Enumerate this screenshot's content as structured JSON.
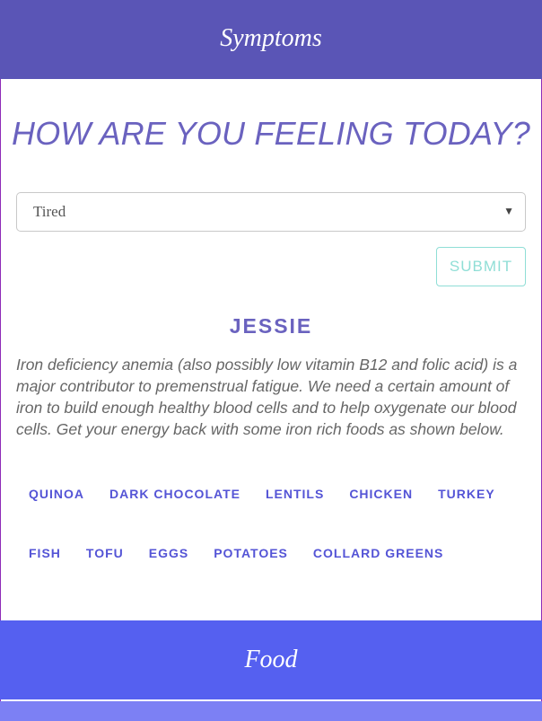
{
  "header": {
    "title": "Symptoms"
  },
  "main": {
    "question": "HOW ARE YOU FEELING TODAY?",
    "symptom_select": {
      "selected": "Tired",
      "caret": "▼"
    },
    "submit_label": "SUBMIT",
    "result": {
      "name": "JESSIE",
      "advice": "Iron deficiency anemia (also possibly low vitamin B12 and folic acid) is a major contributor to premenstrual fatigue. We need a certain amount of iron to build enough healthy blood cells and to help oxygenate our blood cells. Get your energy back with some iron rich foods as shown below.",
      "foods_row1": [
        "QUINOA",
        "DARK CHOCOLATE",
        "LENTILS",
        "CHICKEN",
        "TURKEY"
      ],
      "foods_row2": [
        "FISH",
        "TOFU",
        "EGGS",
        "POTATOES",
        "COLLARD GREENS"
      ]
    }
  },
  "food_section": {
    "title": "Food"
  },
  "colors": {
    "header_bg": "#5a55b6",
    "accent": "#6a62bf",
    "food_tag": "#5454d6",
    "submit_border": "#8fded6",
    "food_bar_bg": "#5560f0",
    "bottom_strip_bg": "#7c80f4"
  }
}
